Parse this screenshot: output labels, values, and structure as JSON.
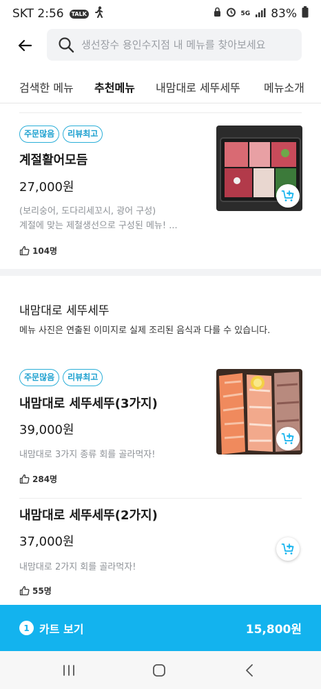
{
  "status_bar": {
    "carrier_time": "SKT 2:56",
    "talk_badge": "TALK",
    "battery": "83%",
    "network": "5G",
    "icons": [
      "talk-icon",
      "walking-icon",
      "lock-icon",
      "alarm-icon",
      "signal-icon",
      "battery-icon"
    ]
  },
  "search": {
    "placeholder": "생선장수 용인수지점 내 메뉴를 찾아보세요",
    "value": ""
  },
  "tabs": [
    {
      "label": "검색한 메뉴",
      "active": false
    },
    {
      "label": "추천메뉴",
      "active": true
    },
    {
      "label": "내맘대로 세뚜세뚜",
      "active": false
    },
    {
      "label": "메뉴소개",
      "active": false
    }
  ],
  "items": [
    {
      "badges": [
        "주문많음",
        "리뷰최고"
      ],
      "name": "계절활어모듬",
      "price": "27,000원",
      "desc_line1": "(보리숭어, 도다리세꼬시, 광어 구성)",
      "desc_line2": "계절에 맞는 제철생선으로 구성된 메뉴! ...",
      "likes": "104명"
    },
    {
      "badges": [
        "주문많음",
        "리뷰최고"
      ],
      "name": "내맘대로 세뚜세뚜(3가지)",
      "price": "39,000원",
      "desc_line1": "내맘대로 3가지 종류 회를 골라먹자!",
      "likes": "284명"
    },
    {
      "name": "내맘대로 세뚜세뚜(2가지)",
      "price": "37,000원",
      "desc_line1": "내맘대로 2가지 회를 골라먹자!",
      "likes": "55명"
    }
  ],
  "section": {
    "title": "내맘대로 세뚜세뚜",
    "note": "메뉴 사진은 연출된 이미지로 실제 조리된 음식과 다를 수 있습니다."
  },
  "cart": {
    "count": "1",
    "label": "카트 보기",
    "total": "15,800원"
  },
  "colors": {
    "accent": "#13b3ee",
    "badge_border": "#2aaed8",
    "tab_indicator": "#1d2340"
  }
}
